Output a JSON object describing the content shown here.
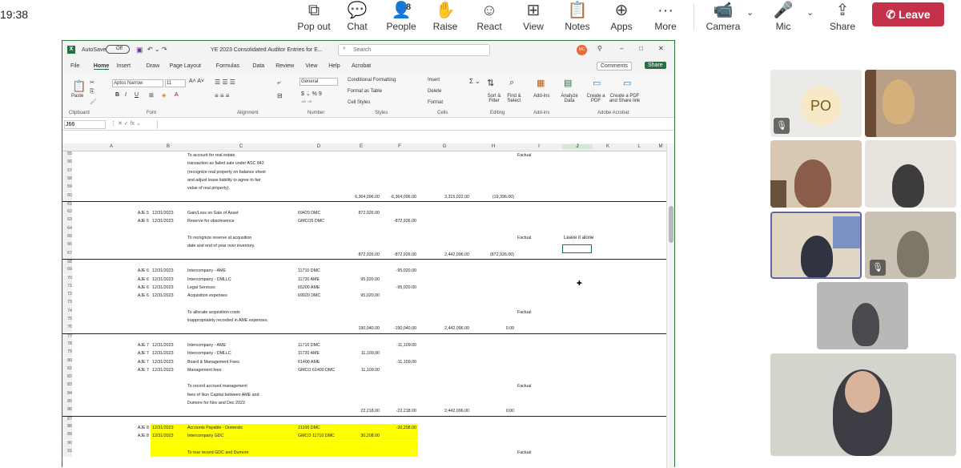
{
  "meeting": {
    "time": "19:38",
    "toolbar": [
      {
        "name": "pop-out",
        "label": "Pop out",
        "icon": "⧉"
      },
      {
        "name": "chat",
        "label": "Chat",
        "icon": "💬"
      },
      {
        "name": "people",
        "label": "People",
        "icon": "👤",
        "count": "8"
      },
      {
        "name": "raise",
        "label": "Raise",
        "icon": "✋"
      },
      {
        "name": "react",
        "label": "React",
        "icon": "☺"
      },
      {
        "name": "view",
        "label": "View",
        "icon": "⊞"
      },
      {
        "name": "notes",
        "label": "Notes",
        "icon": "📋"
      },
      {
        "name": "apps",
        "label": "Apps",
        "icon": "⊕"
      },
      {
        "name": "more",
        "label": "More",
        "icon": "···"
      },
      {
        "name": "camera",
        "label": "Camera",
        "icon": "📹"
      },
      {
        "name": "mic",
        "label": "Mic",
        "icon": "🎤"
      },
      {
        "name": "share",
        "label": "Share",
        "icon": "⇪"
      }
    ],
    "leave_label": "Leave",
    "tiles": [
      {
        "initials": "PO"
      }
    ]
  },
  "excel": {
    "autosave": "AutoSave",
    "autosave_state": "Off",
    "filename": "YE 2023 Consolidated Auditor Entries for E...",
    "search_placeholder": "Search",
    "user_initials": "MC",
    "menu": [
      "File",
      "Home",
      "Insert",
      "Draw",
      "Page Layout",
      "Formulas",
      "Data",
      "Review",
      "View",
      "Help",
      "Acrobat"
    ],
    "comments_label": "Comments",
    "share_label": "Share",
    "ribbon": {
      "paste": "Paste",
      "clipboard": "Clipboard",
      "font_name": "Aptos Narrow",
      "font_size": "11",
      "font": "Font",
      "alignment": "Alignment",
      "number_format": "General",
      "number": "Number",
      "cond_format": "Conditional Formatting",
      "format_table": "Format as Table",
      "cell_styles": "Cell Styles",
      "styles": "Styles",
      "insert": "Insert",
      "delete": "Delete",
      "format": "Format",
      "cells": "Cells",
      "sort_filter": "Sort & Filter",
      "find_select": "Find & Select",
      "editing": "Editing",
      "addins": "Add-ins",
      "addins_group": "Add-ins",
      "analyze": "Analyze Data",
      "create_pdf": "Create a PDF",
      "create_share": "Create a PDF and Share link",
      "acrobat": "Adobe Acrobat"
    },
    "name_box": "J66",
    "columns": [
      "A",
      "B",
      "C",
      "D",
      "E",
      "F",
      "G",
      "H",
      "I",
      "J",
      "K",
      "L",
      "M"
    ],
    "rows": [
      {
        "n": "55",
        "c": "To account for real estate",
        "i": "Factual"
      },
      {
        "n": "56",
        "c": "transaction as failed sale under ASC 842"
      },
      {
        "n": "57",
        "c": "(recognize real property on balance sheet"
      },
      {
        "n": "58",
        "c": "and adjust lease liability to agree to fair"
      },
      {
        "n": "59",
        "c": "value of real property)."
      },
      {
        "n": "60",
        "e": "6,364,096.00",
        "f": "-6,364,096.00",
        "g": "3,315,022.00",
        "h": "(19,396.00)"
      },
      {
        "n": "61",
        "thick": true
      },
      {
        "n": "62",
        "a": "AJE 5",
        "b": "12/31/2023",
        "c": "Gain/Loss on Sale of Asset",
        "d": "69420 DMC",
        "e": "872,926.00"
      },
      {
        "n": "63",
        "a": "AJE 5",
        "b": "12/31/2023",
        "c": "Reserve for obsolesence",
        "d": "GMCO5 DMC",
        "f": "-872,926.00"
      },
      {
        "n": "64"
      },
      {
        "n": "65",
        "c": "To recognize reserve at acqusition",
        "i": "Factual",
        "j": "Leave it alone"
      },
      {
        "n": "66",
        "c": "date and end of year over inventory."
      },
      {
        "n": "67",
        "e": "872,926.00",
        "f": "-872,926.00",
        "g": "2,442,096.00",
        "h": "(872,926.00)"
      },
      {
        "n": "68",
        "thick": true
      },
      {
        "n": "69",
        "a": "AJE 6",
        "b": "12/31/2023",
        "c": "Intercompany - AME",
        "d": "11710 DMC",
        "f": "-95,020.00"
      },
      {
        "n": "70",
        "a": "AJE 6",
        "b": "12/31/2023",
        "c": "Intercompany - DMLLC",
        "d": "11720 AME",
        "e": "95,020.00"
      },
      {
        "n": "71",
        "a": "AJE 6",
        "b": "12/31/2023",
        "c": "Legal Services",
        "d": "65200 AME",
        "f": "-95,020.00"
      },
      {
        "n": "72",
        "a": "AJE 6",
        "b": "12/31/2023",
        "c": "Acquisition expenses",
        "d": "69920 DMC",
        "e": "95,020.00"
      },
      {
        "n": "73"
      },
      {
        "n": "74",
        "c": "To allocate acquisition costs",
        "i": "Factual"
      },
      {
        "n": "75",
        "c": "inappropriately recorded in AME expenses."
      },
      {
        "n": "76",
        "e": "190,040.00",
        "f": "-190,040.00",
        "g": "2,442,096.00",
        "h": "0.00"
      },
      {
        "n": "77",
        "thick": true
      },
      {
        "n": "78",
        "a": "AJE 7",
        "b": "12/31/2023",
        "c": "Intercompany - AME",
        "d": "11710 DMC",
        "f": "-11,109.00"
      },
      {
        "n": "79",
        "a": "AJE 7",
        "b": "12/31/2023",
        "c": "Intercompany - DMLLC",
        "d": "11720 AME",
        "e": "11,109.00"
      },
      {
        "n": "80",
        "a": "AJE 7",
        "b": "12/31/2023",
        "c": "Board & Management Fees",
        "d": "61400 AME",
        "f": "-11,109.00"
      },
      {
        "n": "81",
        "a": "AJE 7",
        "b": "12/31/2023",
        "c": "Management fees",
        "d": "GMCO 61400 DMC",
        "e": "11,109.00"
      },
      {
        "n": "82"
      },
      {
        "n": "83",
        "c": "To record accrued management",
        "i": "Factual"
      },
      {
        "n": "84",
        "c": "fees of Ilion Capital between AME and"
      },
      {
        "n": "85",
        "c": "Dumore for Nov and Dec 2023"
      },
      {
        "n": "86",
        "e": "22,218.00",
        "f": "-22,218.00",
        "g": "2,442,096.00",
        "h": "0.00"
      },
      {
        "n": "87",
        "thick": true
      },
      {
        "n": "88",
        "a": "AJE 8",
        "b": "12/31/2023",
        "c": "Accounts Payable - Domestic",
        "d": "21100 DMC",
        "f": "-30,208.00",
        "hl": true
      },
      {
        "n": "89",
        "a": "AJE 8",
        "b": "12/31/2023",
        "c": "Intercompany GDC",
        "d": "GMCO 11710 DMC",
        "e": "30,208.00",
        "hl": true
      },
      {
        "n": "90",
        "hl": true
      },
      {
        "n": "91",
        "c": "To true record GDC and Dumore",
        "i": "Factual",
        "hl": true
      }
    ]
  }
}
